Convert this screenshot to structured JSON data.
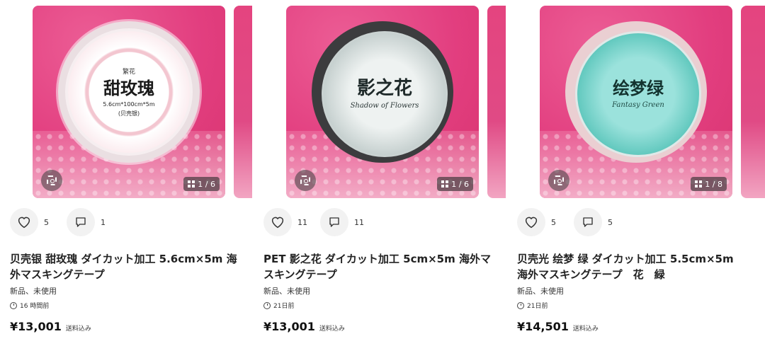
{
  "products": [
    {
      "tape_title": "甜玫瑰",
      "tape_top": "繁花",
      "tape_size": "5.6cm*100cm*5m",
      "tape_finish": "(贝壳银)",
      "image_count": "1 / 6",
      "likes": "5",
      "comments": "1",
      "title": "贝壳银 甜玫瑰 ダイカット加工 5.6cm×5m 海外マスキングテープ",
      "condition": "新品、未使用",
      "posted": "16 時間前",
      "price": "¥13,001",
      "shipping": "送料込み"
    },
    {
      "tape_title": "影之花",
      "tape_subtitle": "Shadow of Flowers",
      "image_count": "1 / 6",
      "likes": "11",
      "comments": "11",
      "title": "PET 影之花 ダイカット加工 5cm×5m 海外マスキングテープ",
      "condition": "新品、未使用",
      "posted": "21日前",
      "price": "¥13,001",
      "shipping": "送料込み"
    },
    {
      "tape_title": "绘梦绿",
      "tape_subtitle": "Fantasy Green",
      "image_count": "1 / 8",
      "likes": "5",
      "comments": "5",
      "title": "贝壳光 绘梦 绿 ダイカット加工 5.5cm×5m 海外マスキングテープ　花　緑",
      "condition": "新品、未使用",
      "posted": "21日前",
      "price": "¥14,501",
      "shipping": "送料込み"
    }
  ],
  "colors": {
    "accent_pink": "#e23e7f",
    "button_bg": "#f2f2f2",
    "text": "#222222"
  },
  "icons": [
    "heart-icon",
    "comment-icon",
    "image-search-icon",
    "gallery-grid-icon",
    "clock-icon"
  ]
}
